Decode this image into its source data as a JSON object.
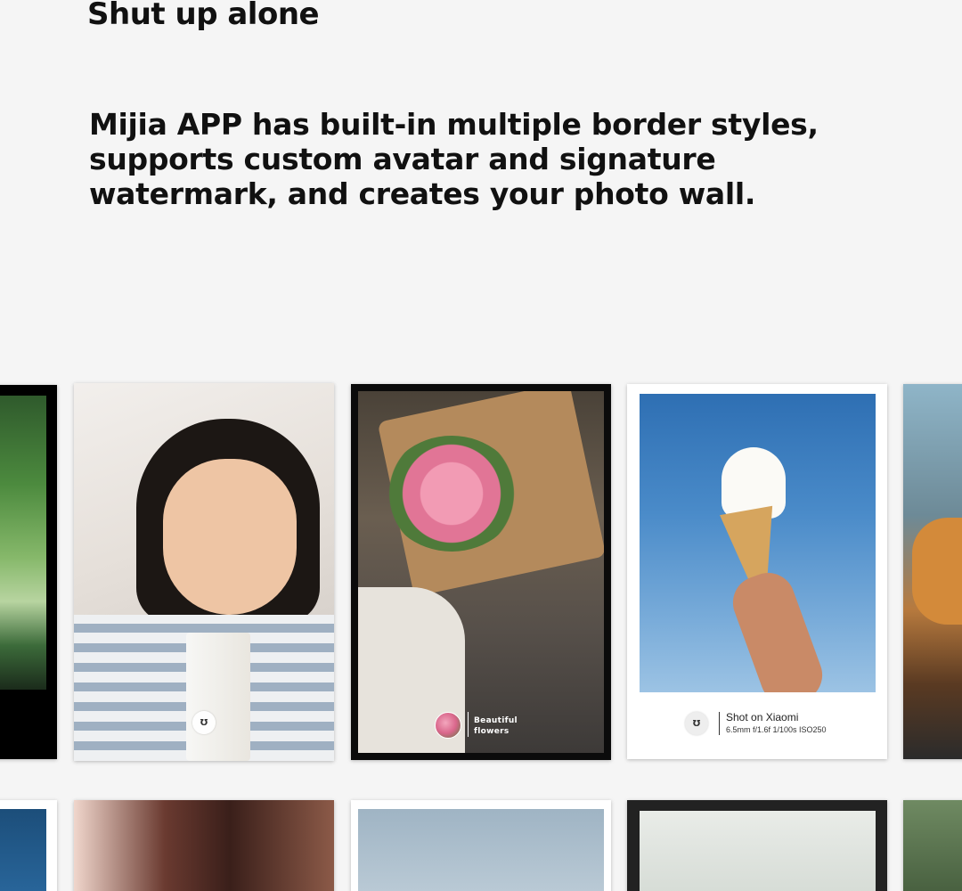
{
  "heading": {
    "title": "Shut up alone",
    "description": "Mijia APP has built-in multiple border styles, supports custom avatar and signature watermark, and creates your photo wall."
  },
  "photo_wall": {
    "row1": [
      {
        "id": "photo-left-edge"
      },
      {
        "id": "photo-girl-milk",
        "logo_glyph": "Ʊ"
      },
      {
        "id": "photo-bouquet",
        "caption_line1": "Beautiful",
        "caption_line2": "flowers"
      },
      {
        "id": "photo-ice-cream",
        "logo_glyph": "Ʊ",
        "caption_title": "Shot on Xiaomi",
        "caption_specs": "6.5mm f/1.6f 1/100s ISO250"
      },
      {
        "id": "photo-cat-edge"
      }
    ],
    "row2": [
      {
        "id": "photo-r2-1"
      },
      {
        "id": "photo-r2-2"
      },
      {
        "id": "photo-r2-3"
      },
      {
        "id": "photo-r2-4"
      },
      {
        "id": "photo-r2-5"
      }
    ]
  }
}
